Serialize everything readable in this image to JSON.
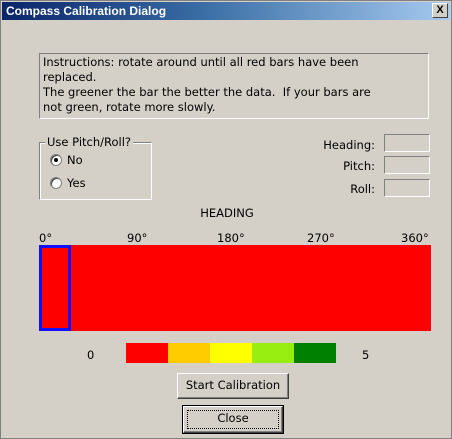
{
  "window": {
    "title": "Compass Calibration Dialog",
    "close_glyph": "X"
  },
  "instructions": {
    "lines": [
      "Instructions: rotate around until all red bars have been",
      "replaced.",
      "The greener the bar the better the data.  If your bars are",
      "not green, rotate more slowly."
    ]
  },
  "pitch_roll": {
    "legend": "Use Pitch/Roll?",
    "options": [
      {
        "label": "No",
        "checked": true
      },
      {
        "label": "Yes",
        "checked": false
      }
    ]
  },
  "fields": {
    "heading_label": "Heading:",
    "pitch_label": "Pitch:",
    "roll_label": "Roll:",
    "heading_value": "",
    "pitch_value": "",
    "roll_value": ""
  },
  "heading_chart": {
    "title": "HEADING",
    "ticks": [
      "0°",
      "90°",
      "180°",
      "270°",
      "360°"
    ],
    "bar_color": "#ff0000",
    "cursor_color": "#1010ff",
    "cursor_heading_deg": 0
  },
  "quality_scale": {
    "min_label": "0",
    "max_label": "5",
    "colors": [
      "#ff0000",
      "#ffcc00",
      "#ffff00",
      "#99ee11",
      "#008000"
    ]
  },
  "buttons": {
    "start_label": "Start Calibration",
    "close_label": "Close"
  }
}
